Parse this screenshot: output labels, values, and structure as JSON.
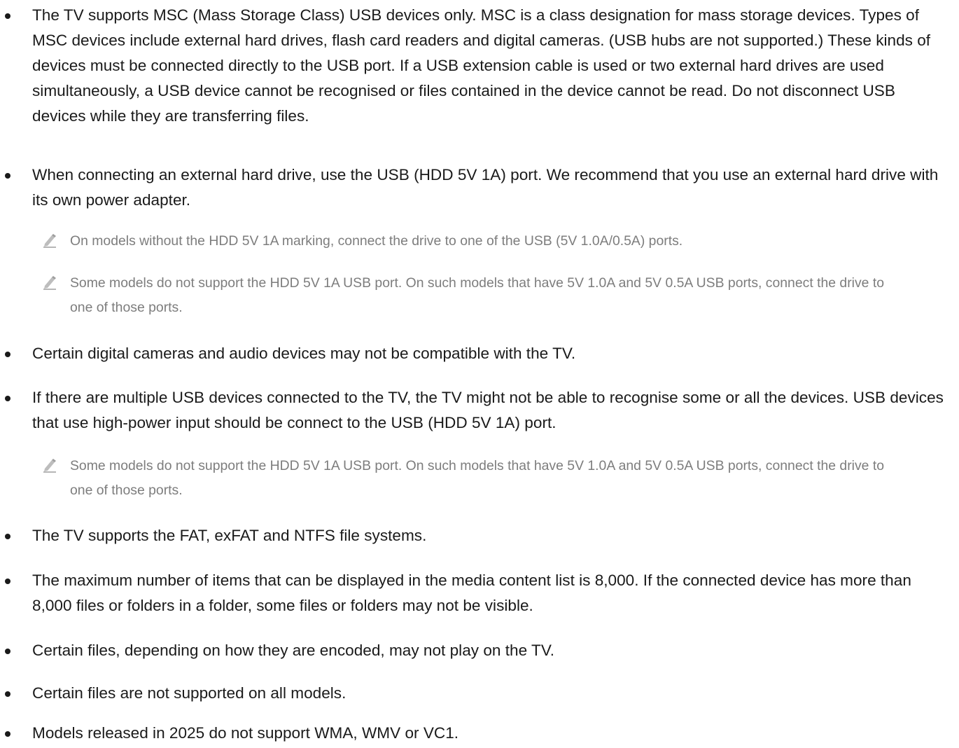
{
  "bullets": [
    {
      "text": "The TV supports MSC (Mass Storage Class) USB devices only. MSC is a class designation for mass storage devices. Types of MSC devices include external hard drives, flash card readers and digital cameras. (USB hubs are not supported.) These kinds of devices must be connected directly to the USB port. If a USB extension cable is used or two external hard drives are used simultaneously, a USB device cannot be recognised or files contained in the device cannot be read. Do not disconnect USB devices while they are transferring files."
    },
    {
      "text": "When connecting an external hard drive, use the USB (HDD 5V 1A) port. We recommend that you use an external hard drive with its own power adapter."
    },
    {
      "text": "Certain digital cameras and audio devices may not be compatible with the TV."
    },
    {
      "text": "If there are multiple USB devices connected to the TV, the TV might not be able to recognise some or all the devices. USB devices that use high-power input should be connect to the USB (HDD 5V 1A) port."
    },
    {
      "text": "The TV supports the FAT, exFAT and NTFS file systems."
    },
    {
      "text": "The maximum number of items that can be displayed in the media content list is 8,000. If the connected device has more than 8,000 files or folders in a folder, some files or folders may not be visible."
    },
    {
      "text": "Certain files, depending on how they are encoded, may not play on the TV."
    },
    {
      "text": "Certain files are not supported on all models."
    },
    {
      "text": "Models released in 2025 do not support WMA, WMV or VC1."
    }
  ],
  "notes": [
    {
      "text": "On models without the HDD 5V 1A marking, connect the drive to one of the USB (5V 1.0A/0.5A) ports.",
      "icon": "pencil-note-icon"
    },
    {
      "text": "Some models do not support the HDD 5V 1A USB port. On such models that have 5V 1.0A and 5V 0.5A USB ports, connect the drive to one of those ports.",
      "icon": "pencil-note-icon"
    },
    {
      "text": "Some models do not support the HDD 5V 1A USB port. On such models that have 5V 1.0A and 5V 0.5A USB ports, connect the drive to one of those ports.",
      "icon": "pencil-note-icon"
    }
  ],
  "colors": {
    "body_text": "#1a1a1a",
    "note_text": "#7d7d7d",
    "background": "#ffffff"
  }
}
